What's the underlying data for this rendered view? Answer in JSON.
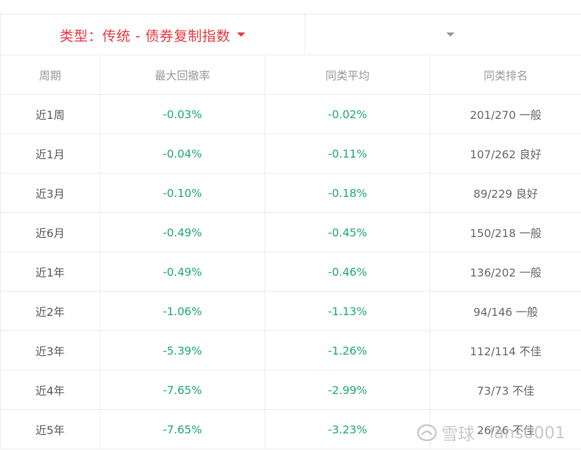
{
  "filter": {
    "type_label": "类型：传统 - 债券复制指数"
  },
  "table": {
    "headers": [
      "周期",
      "最大回撤率",
      "同类平均",
      "同类排名"
    ],
    "rows": [
      {
        "period": "近1周",
        "max_drawdown": "-0.03%",
        "avg": "-0.02%",
        "rank": "201/270 一般"
      },
      {
        "period": "近1月",
        "max_drawdown": "-0.04%",
        "avg": "-0.11%",
        "rank": "107/262 良好"
      },
      {
        "period": "近3月",
        "max_drawdown": "-0.10%",
        "avg": "-0.18%",
        "rank": "89/229 良好"
      },
      {
        "period": "近6月",
        "max_drawdown": "-0.49%",
        "avg": "-0.45%",
        "rank": "150/218 一般"
      },
      {
        "period": "近1年",
        "max_drawdown": "-0.49%",
        "avg": "-0.46%",
        "rank": "136/202 一般"
      },
      {
        "period": "近2年",
        "max_drawdown": "-1.06%",
        "avg": "-1.13%",
        "rank": "94/146 一般"
      },
      {
        "period": "近3年",
        "max_drawdown": "-5.39%",
        "avg": "-1.26%",
        "rank": "112/114 不佳"
      },
      {
        "period": "近4年",
        "max_drawdown": "-7.65%",
        "avg": "-2.99%",
        "rank": "73/73 不佳"
      },
      {
        "period": "近5年",
        "max_drawdown": "-7.65%",
        "avg": "-3.23%",
        "rank": "26/26 不佳"
      }
    ]
  },
  "colors": {
    "accent_red": "#e8353c",
    "value_green": "#1aaa6c",
    "header_grey": "#999999"
  },
  "watermark": {
    "brand": "雪球",
    "user": "· lans0001"
  }
}
